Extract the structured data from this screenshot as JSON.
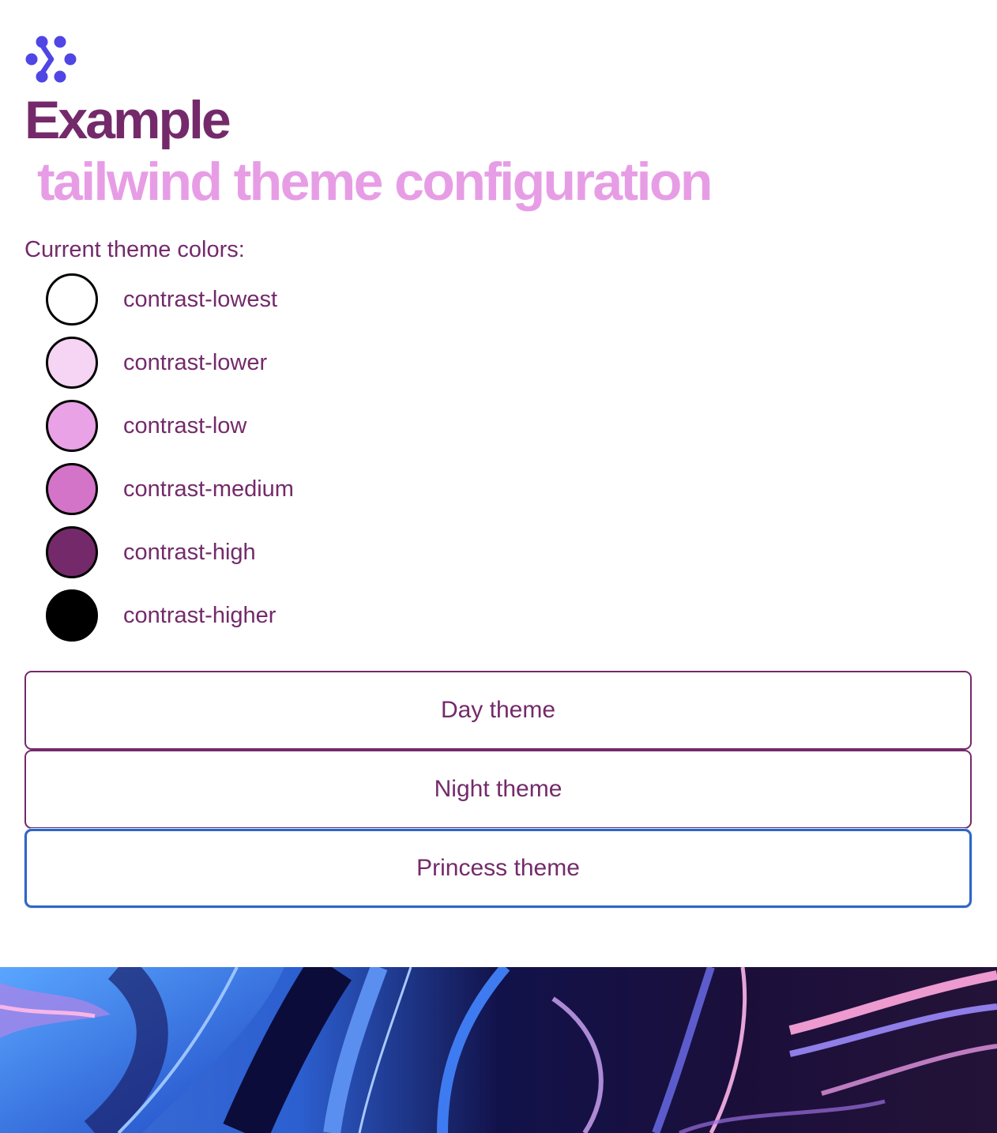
{
  "header": {
    "logo_icon": "dots-chevron-logo-icon",
    "title": "Example",
    "subtitle": "tailwind theme configuration"
  },
  "colors": {
    "heading": "Current theme colors:",
    "items": [
      {
        "label": "contrast-lowest",
        "color": "#ffffff"
      },
      {
        "label": "contrast-lower",
        "color": "#f5d5f3"
      },
      {
        "label": "contrast-low",
        "color": "#e9a2e6"
      },
      {
        "label": "contrast-medium",
        "color": "#d374c9"
      },
      {
        "label": "contrast-high",
        "color": "#742a6a"
      },
      {
        "label": "contrast-higher",
        "color": "#000000"
      }
    ]
  },
  "themes": {
    "buttons": [
      {
        "label": "Day theme"
      },
      {
        "label": "Night theme"
      },
      {
        "label": "Princess theme"
      }
    ],
    "focused": "Princess theme"
  },
  "palette": {
    "text": "#742a6a",
    "accent_light": "#e79de5",
    "logo": "#4f46e5",
    "focus_ring": "#2d66c8"
  }
}
